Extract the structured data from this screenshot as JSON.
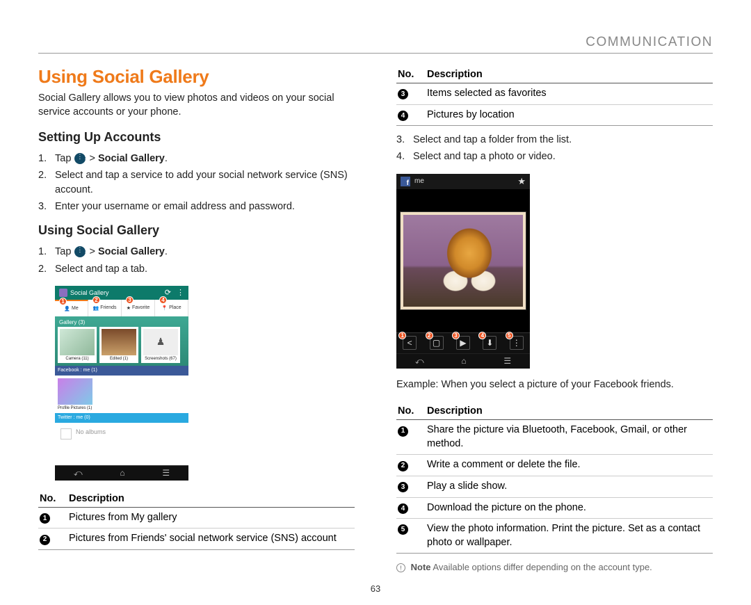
{
  "header": {
    "section": "COMMUNICATION"
  },
  "page_number": "63",
  "left": {
    "title": "Using Social Gallery",
    "intro": "Social Gallery allows you to view photos and videos on your social service accounts or your phone.",
    "setup_title": "Setting Up Accounts",
    "setup_steps": [
      {
        "n": "1.",
        "pre": "Tap ",
        "post": " > ",
        "bold": "Social Gallery",
        "tail": "."
      },
      {
        "n": "2.",
        "text": "Select and tap a service to add your social network service (SNS) account."
      },
      {
        "n": "3.",
        "text": "Enter your username or email address and password."
      }
    ],
    "using_title": "Using Social Gallery",
    "using_steps": [
      {
        "n": "1.",
        "pre": "Tap ",
        "post": " > ",
        "bold": "Social Gallery",
        "tail": "."
      },
      {
        "n": "2.",
        "text": "Select and tap a tab."
      }
    ],
    "mock1": {
      "title": "Social Gallery",
      "tabs": [
        "Me",
        "Friends",
        "Favorite",
        "Place"
      ],
      "callouts": [
        "1",
        "2",
        "3",
        "4"
      ],
      "gallery_label": "Gallery (3)",
      "thumbs": [
        "Camera (11)",
        "Edited (1)",
        "Screenshots (67)"
      ],
      "fb_label": "Facebook : me (1)",
      "pp_label": "Profile Pictures (1)",
      "tw_label": "Twitter : me (0)",
      "empty": "No albums"
    },
    "table_header": {
      "no": "No.",
      "desc": "Description"
    },
    "table_rows": [
      {
        "n": "1",
        "d": "Pictures from My gallery"
      },
      {
        "n": "2",
        "d": "Pictures from Friends' social network service (SNS) account"
      }
    ]
  },
  "right": {
    "top_table": {
      "header": {
        "no": "No.",
        "desc": "Description"
      },
      "rows": [
        {
          "n": "3",
          "d": "Items selected as favorites"
        },
        {
          "n": "4",
          "d": "Pictures by location"
        }
      ]
    },
    "steps": [
      {
        "n": "3.",
        "text": "Select and tap a folder from the list."
      },
      {
        "n": "4.",
        "text": "Select and tap a photo or video."
      }
    ],
    "mock2": {
      "name": "me",
      "callouts": [
        "1",
        "2",
        "3",
        "4",
        "5"
      ]
    },
    "example": "Example: When you select a picture of your Facebook friends.",
    "bottom_table": {
      "header": {
        "no": "No.",
        "desc": "Description"
      },
      "rows": [
        {
          "n": "1",
          "d": "Share the picture via Bluetooth, Facebook, Gmail, or other method."
        },
        {
          "n": "2",
          "d": "Write a comment or delete the file."
        },
        {
          "n": "3",
          "d": "Play a slide show."
        },
        {
          "n": "4",
          "d": "Download the picture on the phone."
        },
        {
          "n": "5",
          "d": "View the photo information. Print the picture. Set as a contact photo or wallpaper."
        }
      ]
    },
    "note_label": "Note",
    "note_text": "Available options differ depending on the account type."
  }
}
